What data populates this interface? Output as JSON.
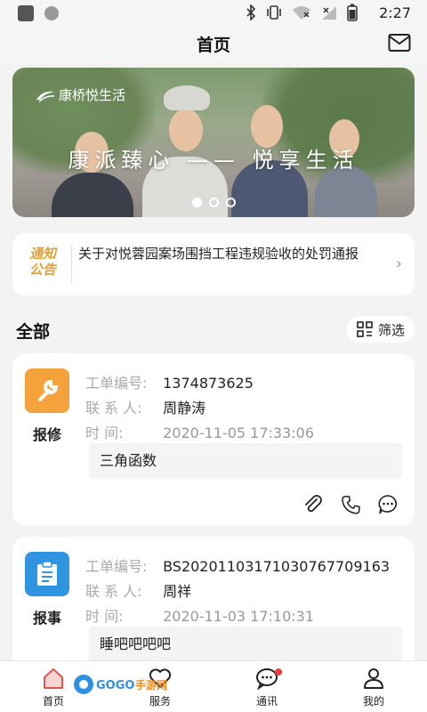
{
  "status_bar": {
    "time": "2:27"
  },
  "header": {
    "title": "首页"
  },
  "banner": {
    "brand": "康桥悦生活",
    "slogan": "康派臻心 —— 悦享生活",
    "slide_count": 3,
    "active_slide": 0
  },
  "notice": {
    "badge_line1": "通知",
    "badge_line2": "公告",
    "text": "关于对悦蓉园案场围挡工程违规验收的处罚通报"
  },
  "section": {
    "title": "全部",
    "filter_label": "筛选"
  },
  "orders": [
    {
      "category": "报修",
      "icon": "wrench-icon",
      "icon_color": "#f5a23c",
      "order_no_label": "工单编号:",
      "order_no": "1374873625",
      "contact_label": "联 系 人:",
      "contact": "周静涛",
      "time_label": "时      间:",
      "time": "2020-11-05 17:33:06",
      "description": "三角函数"
    },
    {
      "category": "报事",
      "icon": "clipboard-icon",
      "icon_color": "#2f95e0",
      "order_no_label": "工单编号:",
      "order_no": "BS20201103171030767709163",
      "contact_label": "联 系 人:",
      "contact": "周祥",
      "time_label": "时      间:",
      "time": "2020-11-03 17:10:31",
      "description": "睡吧吧吧吧"
    }
  ],
  "tabs": [
    {
      "label": "首页",
      "icon": "home-icon",
      "active": true
    },
    {
      "label": "服务",
      "icon": "heart-icon",
      "active": false
    },
    {
      "label": "通讯",
      "icon": "chat-icon",
      "active": false,
      "has_badge": true
    },
    {
      "label": "我的",
      "icon": "person-icon",
      "active": false
    }
  ],
  "colors": {
    "accent_orange": "#f5a23c",
    "accent_blue": "#2f95e0",
    "badge_red": "#f03d3d",
    "notice_gold": "#e0a13a"
  }
}
